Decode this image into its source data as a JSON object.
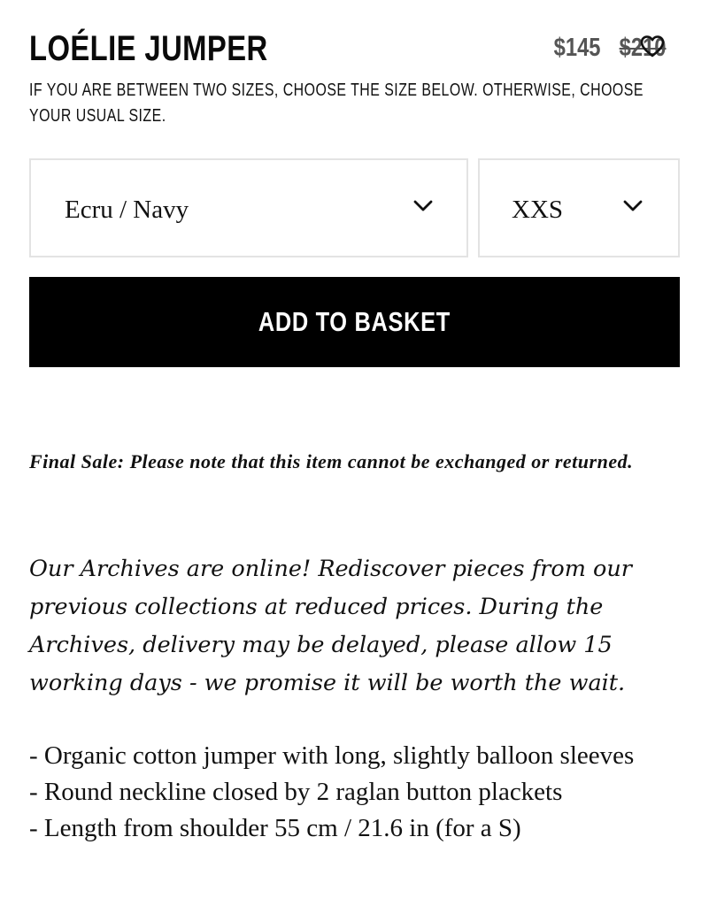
{
  "product": {
    "title": "LOÉLIE JUMPER",
    "price_current": "$145",
    "price_original": "$210",
    "size_note": "IF YOU ARE BETWEEN TWO SIZES, CHOOSE THE SIZE BELOW. OTHERWISE, CHOOSE YOUR USUAL SIZE."
  },
  "options": {
    "color_selected": "Ecru / Navy",
    "size_selected": "XXS"
  },
  "actions": {
    "add_to_basket": "ADD TO BASKET"
  },
  "notice": {
    "final_sale": "Final Sale: Please note that this item cannot be exchanged or returned."
  },
  "description": {
    "archives": "Our Archives are online! Rediscover pieces from our previous collections at reduced prices. During the Archives, delivery may be delayed, please allow 15 working days - we promise it will be worth the wait.",
    "features": [
      "- Organic cotton jumper with long, slightly balloon sleeves",
      "- Round neckline closed by 2 raglan button plackets",
      "- Length from shoulder 55 cm / 21.6 in (for a S)"
    ]
  },
  "icons": {
    "wishlist": "heart-outline-icon",
    "dropdown": "chevron-down-icon"
  },
  "colors": {
    "text": "#111111",
    "price": "#555555",
    "button_bg": "#000000",
    "button_text": "#ffffff",
    "select_border": "#e3e3e3"
  }
}
